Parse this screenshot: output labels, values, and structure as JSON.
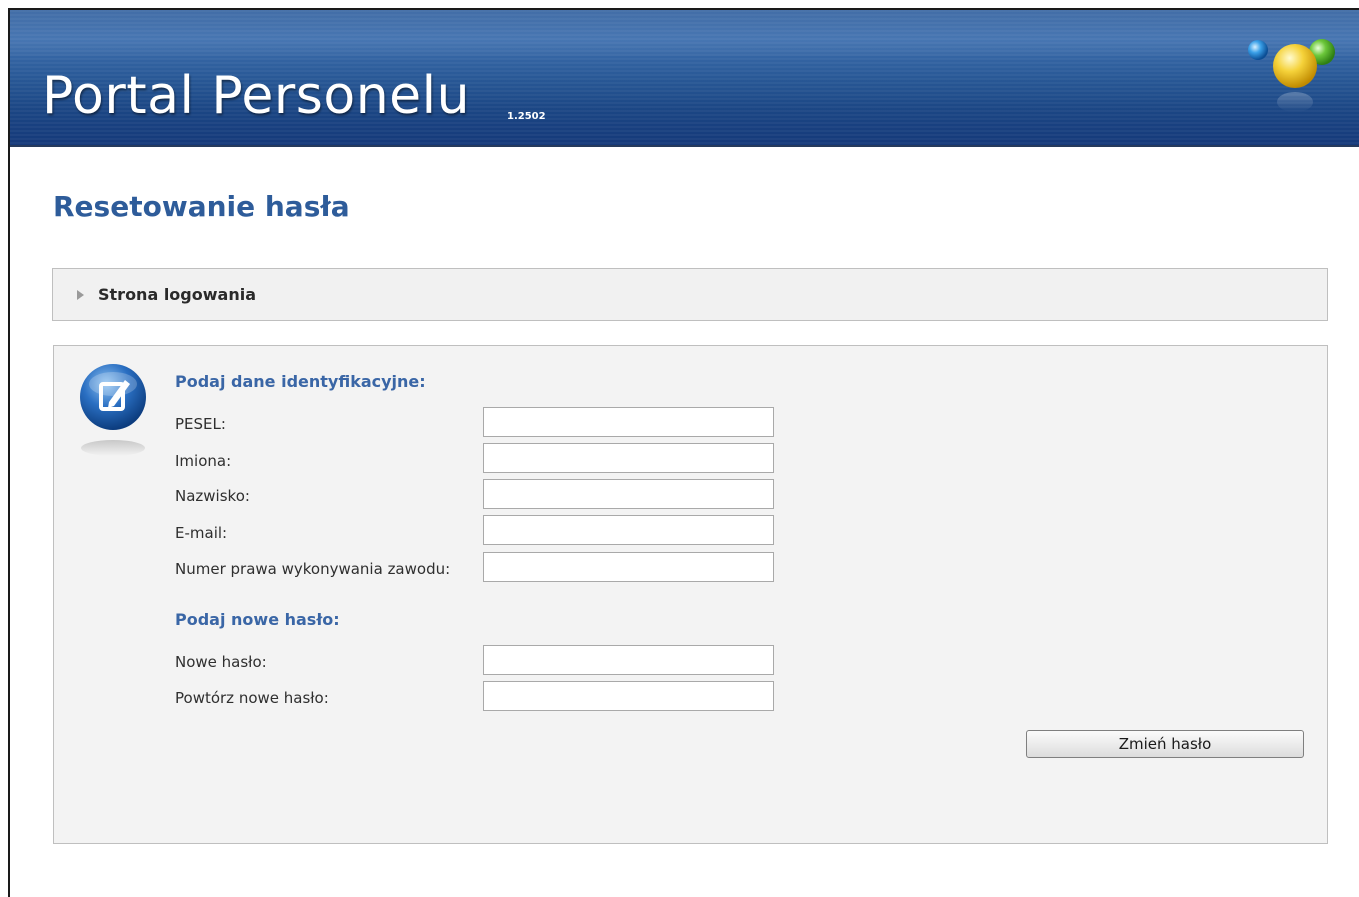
{
  "header": {
    "title": "Portal Personelu",
    "version": "1.2502"
  },
  "page": {
    "heading": "Resetowanie hasła"
  },
  "nav": {
    "login_link": "Strona logowania"
  },
  "form": {
    "identification_title": "Podaj dane identyfikacyjne:",
    "fields_identification": [
      {
        "label": "PESEL:",
        "value": ""
      },
      {
        "label": "Imiona:",
        "value": ""
      },
      {
        "label": "Nazwisko:",
        "value": ""
      },
      {
        "label": "E-mail:",
        "value": ""
      },
      {
        "label": "Numer prawa wykonywania zawodu:",
        "value": ""
      }
    ],
    "password_title": "Podaj nowe hasło:",
    "fields_password": [
      {
        "label": "Nowe hasło:",
        "value": ""
      },
      {
        "label": "Powtórz nowe hasło:",
        "value": ""
      }
    ],
    "submit_label": "Zmień hasło"
  },
  "colors": {
    "header_blue": "#1b4684",
    "heading_blue": "#2e5c9a",
    "section_blue": "#3a66a6",
    "panel_bg": "#f3f3f3"
  },
  "icons": {
    "logo": "colored-balls-logo-icon",
    "nav_arrow": "triangle-right-icon",
    "form": "edit-document-icon"
  }
}
